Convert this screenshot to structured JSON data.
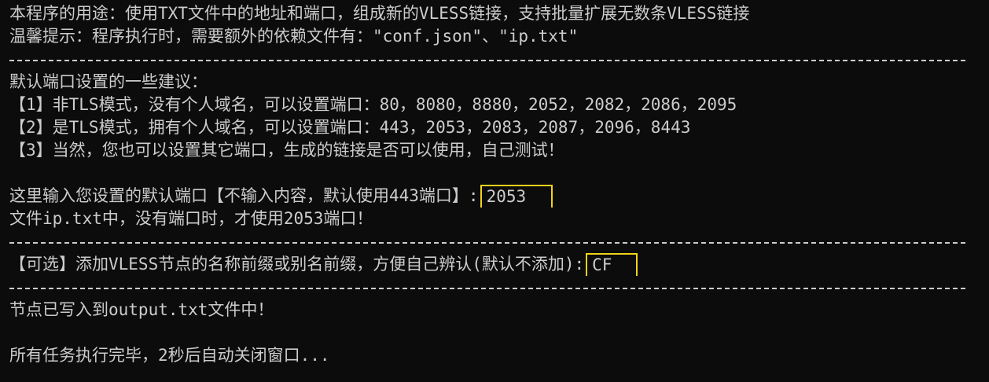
{
  "intro": {
    "purpose": "本程序的用途：使用TXT文件中的地址和端口，组成新的VLESS链接，支持批量扩展无数条VLESS链接",
    "tip": "温馨提示：程序执行时，需要额外的依赖文件有：\"conf.json\"、\"ip.txt\""
  },
  "suggestions": {
    "heading": "默认端口设置的一些建议：",
    "items": [
      "【1】非TLS模式，没有个人域名，可以设置端口：80，8080，8880，2052，2082，2086，2095",
      "【2】是TLS模式，拥有个人域名，可以设置端口：443，2053，2083，2087，2096，8443",
      "【3】当然，您也可以设置其它端口，生成的链接是否可以使用，自己测试！"
    ]
  },
  "port_prompt": {
    "label": "这里输入您设置的默认端口【不输入内容，默认使用443端口】:",
    "value": "2053",
    "note": "文件ip.txt中，没有端口时，才使用2053端口！"
  },
  "prefix_prompt": {
    "label": "【可选】添加VLESS节点的名称前缀或别名前缀，方便自己辨认(默认不添加):",
    "value": "CF"
  },
  "results": {
    "written": "节点已写入到output.txt文件中！",
    "done": "所有任务执行完毕，2秒后自动关闭窗口..."
  },
  "colors": {
    "background": "#0c0c0c",
    "text": "#cccccc",
    "highlight": "#f2d21b"
  }
}
